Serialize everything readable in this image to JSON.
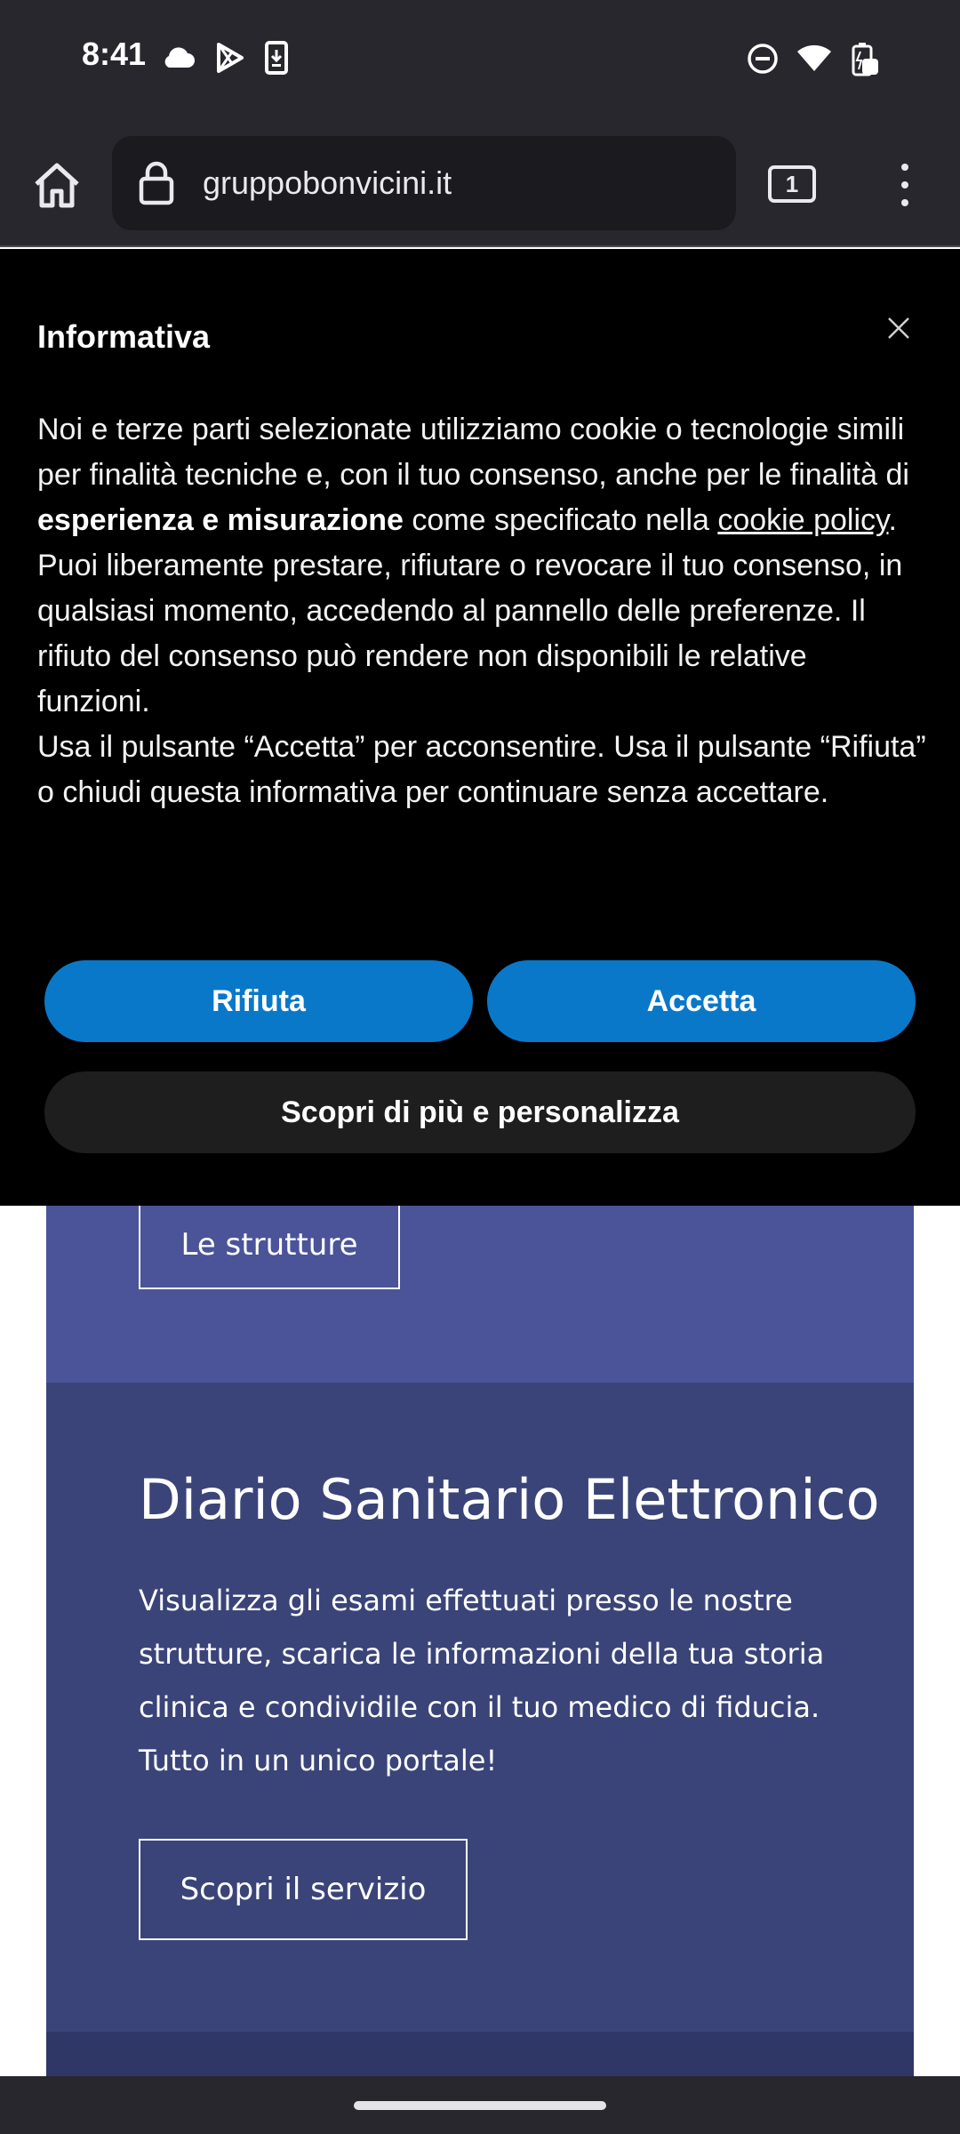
{
  "status_bar": {
    "time": "8:41",
    "left_icons": [
      "cloud-icon",
      "play-store-icon",
      "phone-download-icon"
    ],
    "right_icons": [
      "do-not-disturb-icon",
      "wifi-icon",
      "battery-charging-icon"
    ]
  },
  "browser": {
    "url": "gruppobonvicini.it",
    "tab_count": "1"
  },
  "cookie_banner": {
    "title": "Informativa",
    "para1_a": "Noi e terze parti selezionate utilizziamo cookie o tecnologie simili per finalità tecniche e, con il tuo consenso, anche per le finalità di ",
    "para1_bold": "esperienza e misurazione",
    "para1_b": " come specificato nella ",
    "para1_link": "cookie policy",
    "para1_c": ".",
    "para2": "Puoi liberamente prestare, rifiutare o revocare il tuo consenso, in qualsiasi momento, accedendo al pannello delle preferenze. Il rifiuto del consenso può rendere non disponibili le relative funzioni.",
    "para3": "Usa il pulsante “Accetta” per acconsentire. Usa il pulsante “Rifiuta” o chiudi questa informativa per continuare senza accettare.",
    "reject_label": "Rifiuta",
    "accept_label": "Accetta",
    "customize_label": "Scopri di più e personalizza"
  },
  "page": {
    "strutture_button": "Le strutture",
    "service_title": "Diario Sanitario Elettronico",
    "service_description": "Visualizza gli esami effettuati presso le nostre strutture, scarica le informazioni della tua storia clinica e condividile con il tuo medico di fiducia. Tutto in un unico portale!",
    "service_button": "Scopri il servizio"
  },
  "colors": {
    "accent_blue": "#0a78c8",
    "card_top": "#4b5399",
    "card_mid": "#3a4478"
  }
}
